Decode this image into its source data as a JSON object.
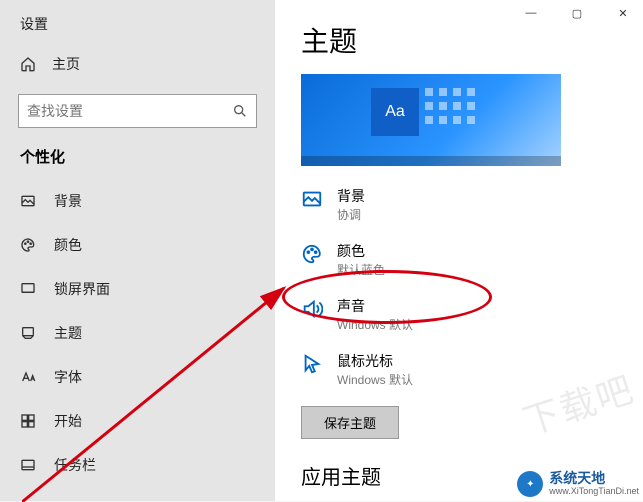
{
  "sidebar": {
    "back_label": "设置",
    "home_label": "主页",
    "search_placeholder": "查找设置",
    "section_title": "个性化",
    "items": [
      {
        "label": "背景"
      },
      {
        "label": "颜色"
      },
      {
        "label": "锁屏界面"
      },
      {
        "label": "主题"
      },
      {
        "label": "字体"
      },
      {
        "label": "开始"
      },
      {
        "label": "任务栏"
      }
    ]
  },
  "main": {
    "page_title": "主题",
    "preview_tile_text": "Aa",
    "settings": [
      {
        "label": "背景",
        "sub": "协调"
      },
      {
        "label": "颜色",
        "sub": "默认蓝色"
      },
      {
        "label": "声音",
        "sub": "Windows 默认"
      },
      {
        "label": "鼠标光标",
        "sub": "Windows 默认"
      }
    ],
    "save_button": "保存主题",
    "apply_section": "应用主题"
  },
  "titlebar": {
    "min": "—",
    "max": "▢",
    "close": "✕"
  },
  "watermark": {
    "faint": "下载吧",
    "brand_cn": "系统天地",
    "brand_en": "www.XiTongTianDi.net"
  }
}
